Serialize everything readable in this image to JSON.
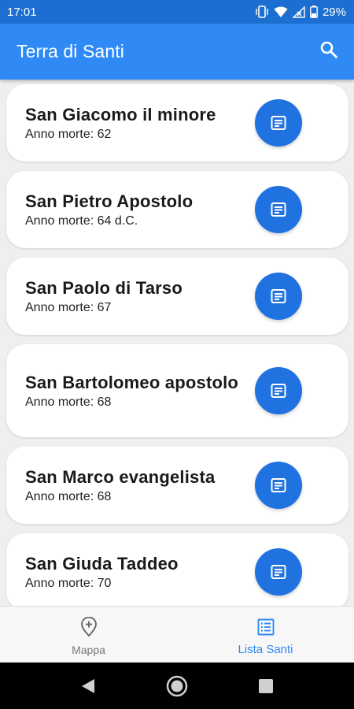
{
  "status_bar": {
    "time": "17:01",
    "battery": "29%",
    "icons": [
      "vibrate-icon",
      "wifi-icon",
      "signal-icon",
      "battery-icon"
    ]
  },
  "app_bar": {
    "title": "Terra di Santi",
    "search_icon": "search-icon"
  },
  "saints": [
    {
      "name": "San Giacomo il minore",
      "year": "Anno morte: 62"
    },
    {
      "name": "San Pietro Apostolo",
      "year": "Anno morte: 64 d.C."
    },
    {
      "name": "San Paolo di Tarso",
      "year": "Anno morte: 67"
    },
    {
      "name": "San Bartolomeo apostolo",
      "year": "Anno morte: 68"
    },
    {
      "name": "San Marco evangelista",
      "year": "Anno morte: 68"
    },
    {
      "name": "San Giuda Taddeo",
      "year": "Anno morte: 70"
    }
  ],
  "bottom_nav": {
    "items": [
      {
        "label": "Mappa",
        "icon": "map-pin-icon",
        "active": false
      },
      {
        "label": "Lista Santi",
        "icon": "list-icon",
        "active": true
      }
    ]
  },
  "colors": {
    "status_bar": "#1c6fd0",
    "app_bar": "#2f8af5",
    "button": "#1f72e0",
    "background": "#efefef"
  }
}
